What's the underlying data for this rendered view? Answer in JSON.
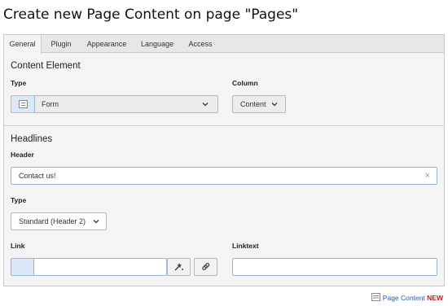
{
  "page": {
    "title": "Create new Page Content on page \"Pages\""
  },
  "tabs": [
    {
      "label": "General",
      "active": true
    },
    {
      "label": "Plugin",
      "active": false
    },
    {
      "label": "Appearance",
      "active": false
    },
    {
      "label": "Language",
      "active": false
    },
    {
      "label": "Access",
      "active": false
    }
  ],
  "content_element": {
    "title": "Content Element",
    "type_label": "Type",
    "type_value": "Form",
    "column_label": "Column",
    "column_value": "Content"
  },
  "headlines": {
    "title": "Headlines",
    "header_label": "Header",
    "header_value": "Contact us!",
    "clear_glyph": "×",
    "type_label": "Type",
    "type_value": "Standard (Header 2)",
    "link_label": "Link",
    "link_value": "",
    "linktext_label": "Linktext",
    "linktext_value": ""
  },
  "footer": {
    "content_label": "Page Content",
    "new_label": "NEW"
  },
  "icons": {
    "form_type": "form-icon",
    "chevron": "chevron-down-icon",
    "link_wizard": "wand-icon",
    "link": "link-icon",
    "page_content": "page-content-icon"
  },
  "colors": {
    "focus_border": "#8fb6dd",
    "link_blue": "#2a5aa3",
    "new_red": "#cc1111"
  }
}
